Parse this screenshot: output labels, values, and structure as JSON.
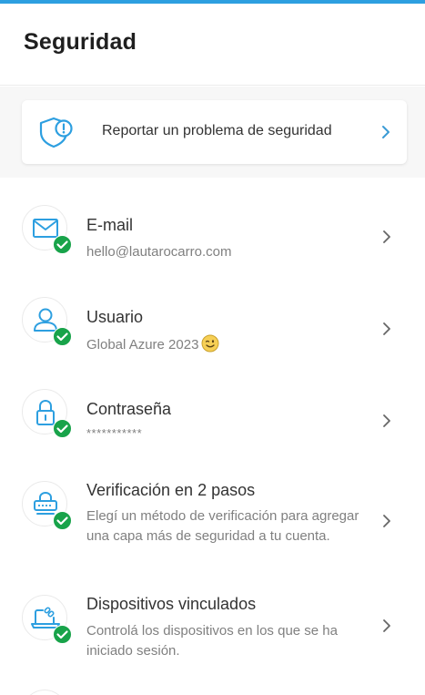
{
  "header": {
    "title": "Seguridad"
  },
  "report": {
    "label": "Reportar un problema de seguridad"
  },
  "items": [
    {
      "title": "E-mail",
      "subtitle": "hello@lautarocarro.com",
      "verified": true,
      "icon": "envelope-icon"
    },
    {
      "title": "Usuario",
      "subtitle": "Global Azure 2023",
      "emoji": "wink-emoji",
      "verified": true,
      "icon": "user-icon"
    },
    {
      "title": "Contraseña",
      "subtitle": "***********",
      "verified": true,
      "icon": "lock-icon"
    },
    {
      "title": "Verificación en 2 pasos",
      "subtitle": "Elegí un método de verificación para agregar una capa más de seguridad a tu cuenta.",
      "verified": true,
      "icon": "keypad-icon"
    },
    {
      "title": "Dispositivos vinculados",
      "subtitle": "Controlá los dispositivos en los que se ha iniciado sesión.",
      "verified": true,
      "icon": "laptop-link-icon"
    }
  ],
  "colors": {
    "accent": "#2d9fe0",
    "success": "#18a34a",
    "chevron_blue": "#3a9bd5",
    "chevron_gray": "#666666"
  }
}
